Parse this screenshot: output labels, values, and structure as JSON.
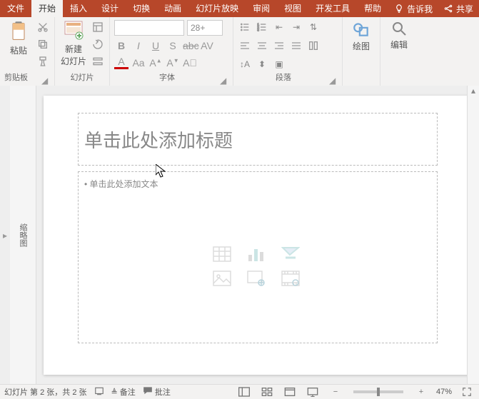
{
  "titlebar": {
    "share": "共享"
  },
  "tabs": {
    "file": "文件",
    "home": "开始",
    "insert": "插入",
    "design": "设计",
    "transition": "切换",
    "animation": "动画",
    "slideshow": "幻灯片放映",
    "review": "审阅",
    "view": "视图",
    "developer": "开发工具",
    "help": "帮助",
    "tellme": "告诉我"
  },
  "ribbon": {
    "clipboard": {
      "paste": "粘贴",
      "label": "剪贴板"
    },
    "slides": {
      "newslide": "新建\n幻灯片",
      "label": "幻灯片"
    },
    "font": {
      "label": "字体",
      "size": "28+"
    },
    "paragraph": {
      "label": "段落"
    },
    "drawing": {
      "btn": "绘图"
    },
    "editing": {
      "btn": "编辑"
    }
  },
  "thumbs": {
    "label": "缩略图"
  },
  "slide": {
    "title_placeholder": "单击此处添加标题",
    "body_placeholder": "单击此处添加文本"
  },
  "status": {
    "slideinfo": "幻灯片 第 2 张，共 2 张",
    "notes": "备注",
    "comments": "批注",
    "zoom": "47%"
  }
}
